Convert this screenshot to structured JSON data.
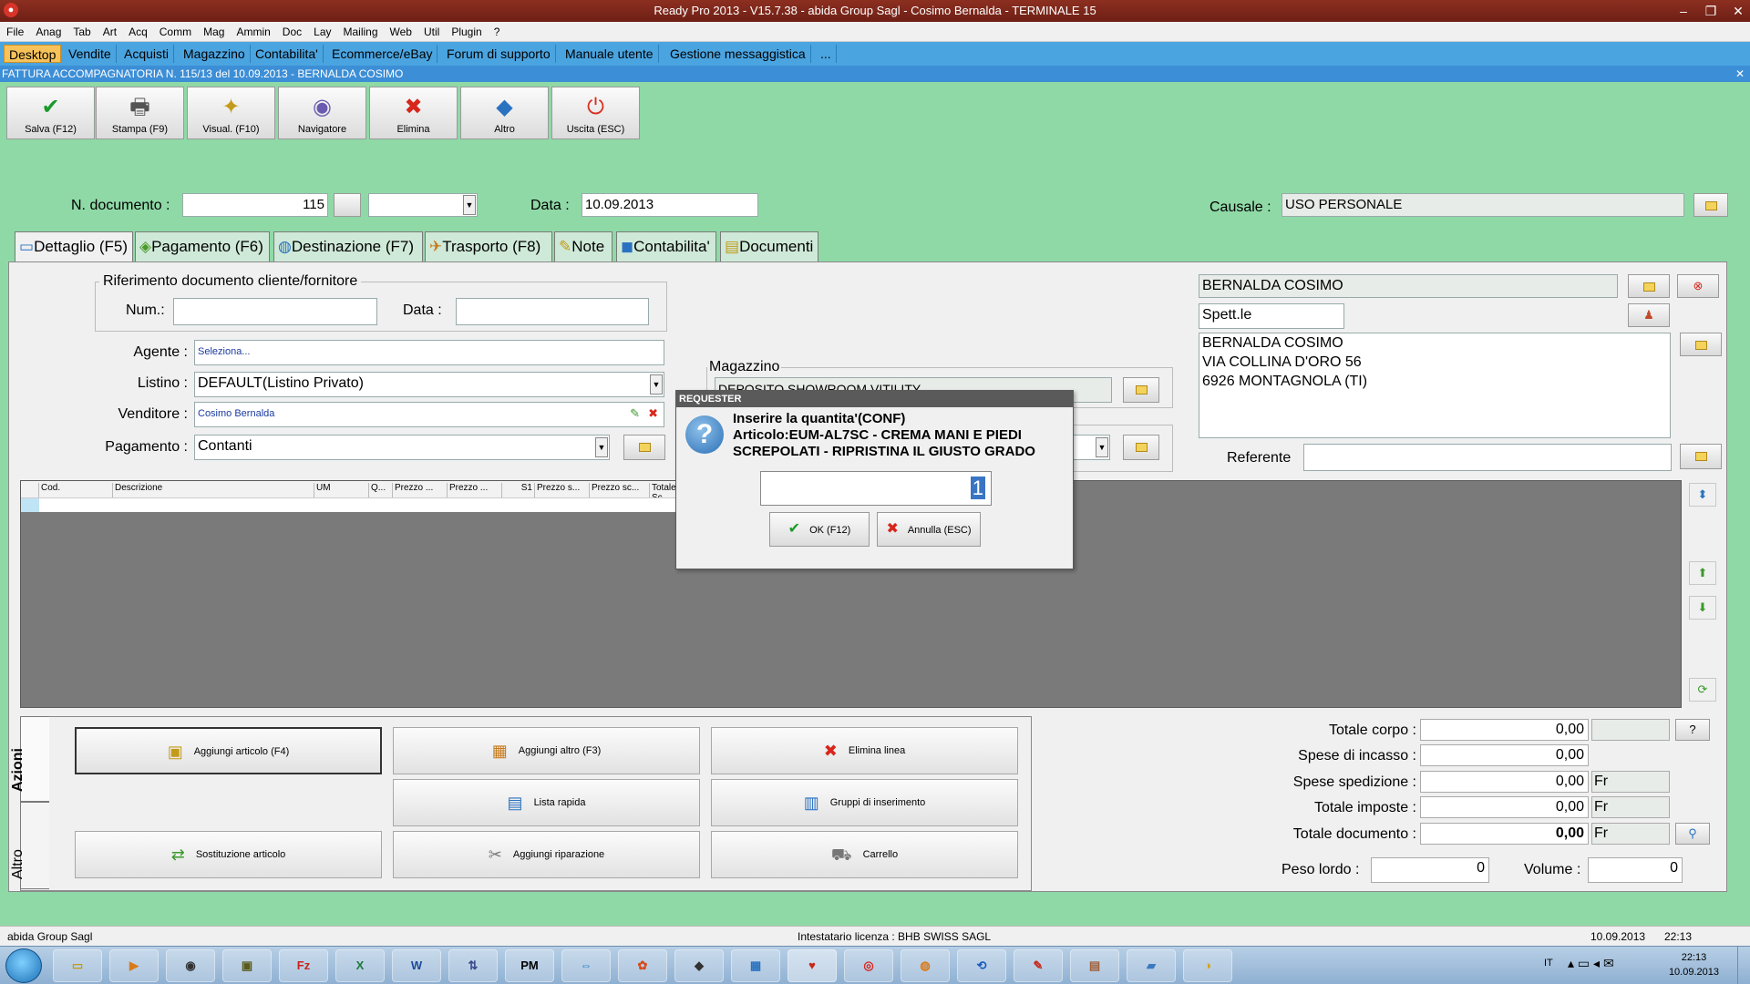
{
  "window": {
    "title": "Ready Pro 2013 - V15.7.38 - abida Group Sagl - Cosimo Bernalda - TERMINALE 15"
  },
  "menu": [
    "File",
    "Anag",
    "Tab",
    "Art",
    "Acq",
    "Comm",
    "Mag",
    "Ammin",
    "Doc",
    "Lay",
    "Mailing",
    "Web",
    "Util",
    "Plugin",
    "?"
  ],
  "top_tabs": [
    "Desktop",
    "Vendite",
    "Acquisti",
    "Magazzino",
    "Contabilita'",
    "Ecommerce/eBay",
    "Forum di supporto",
    "Manuale utente",
    "Gestione messaggistica",
    "..."
  ],
  "doc_title": "FATTURA ACCOMPAGNATORIA N. 115/13 del 10.09.2013 - BERNALDA COSIMO",
  "toolbar": [
    {
      "label": "Salva (F12)",
      "icon": "check-icon"
    },
    {
      "label": "Stampa (F9)",
      "icon": "printer-icon"
    },
    {
      "label": "Visual. (F10)",
      "icon": "wand-icon"
    },
    {
      "label": "Navigatore",
      "icon": "navigator-icon"
    },
    {
      "label": "Elimina",
      "icon": "delete-icon"
    },
    {
      "label": "Altro",
      "icon": "other-icon"
    },
    {
      "label": "Uscita (ESC)",
      "icon": "exit-icon"
    }
  ],
  "header": {
    "ndoc_label": "N. documento :",
    "ndoc_value": "115",
    "data_label": "Data :",
    "data_value": "10.09.2013",
    "causale_label": "Causale :",
    "causale_value": "USO PERSONALE"
  },
  "content_tabs": [
    "Dettaglio (F5)",
    "Pagamento (F6)",
    "Destinazione (F7)",
    "Trasporto (F8)",
    "Note",
    "Contabilita'",
    "Documenti"
  ],
  "riferimento": {
    "legend": "Riferimento documento cliente/fornitore",
    "num_label": "Num.:",
    "data_label": "Data :"
  },
  "fields": {
    "agente_label": "Agente :",
    "agente_value": "Seleziona...",
    "listino_label": "Listino :",
    "listino_value": "DEFAULT(Listino Privato)",
    "venditore_label": "Venditore :",
    "venditore_value": "Cosimo Bernalda",
    "pagamento_label": "Pagamento :",
    "pagamento_value": "Contanti",
    "magazzino_label": "Magazzino",
    "magazzino_value": "DEPOSITO SHOWROOM VITILITY"
  },
  "client": {
    "name": "BERNALDA COSIMO",
    "salutation": "Spett.le",
    "address_lines": [
      "BERNALDA COSIMO",
      "VIA COLLINA D'ORO 56",
      "6926 MONTAGNOLA (TI)"
    ],
    "referente_label": "Referente"
  },
  "grid_columns": [
    "Cod.",
    "Descrizione",
    "UM",
    "Q...",
    "Prezzo ...",
    "Prezzo ...",
    "S1",
    "Prezzo s...",
    "Prezzo sc...",
    "Totale Sc..."
  ],
  "actions_tabs": [
    "Azioni",
    "Altro"
  ],
  "actions": [
    {
      "label": "Aggiungi articolo (F4)",
      "icon": "add-article-icon"
    },
    {
      "label": "Aggiungi altro (F3)",
      "icon": "add-other-icon"
    },
    {
      "label": "Elimina linea",
      "icon": "delete-line-icon"
    },
    {
      "label": "Lista rapida",
      "icon": "quick-list-icon"
    },
    {
      "label": "Gruppi di inserimento",
      "icon": "insert-groups-icon"
    },
    {
      "label": "Sostituzione articolo",
      "icon": "replace-article-icon"
    },
    {
      "label": "Aggiungi riparazione",
      "icon": "add-repair-icon"
    },
    {
      "label": "Carrello",
      "icon": "cart-icon"
    }
  ],
  "totals": {
    "totale_corpo_label": "Totale corpo :",
    "totale_corpo": "0,00",
    "spese_incasso_label": "Spese di incasso :",
    "spese_incasso": "0,00",
    "spese_spedizione_label": "Spese spedizione :",
    "spese_spedizione": "0,00",
    "totale_imposte_label": "Totale imposte :",
    "totale_imposte": "0,00",
    "totale_documento_label": "Totale documento :",
    "totale_documento": "0,00",
    "currency": "Fr",
    "peso_label": "Peso lordo :",
    "peso": "0",
    "volume_label": "Volume :",
    "volume": "0",
    "help": "?"
  },
  "dialog": {
    "title": "REQUESTER",
    "line1": "Inserire la quantita'(CONF)",
    "line2": "Articolo:EUM-AL7SC - CREMA MANI E PIEDI",
    "line3": "SCREPOLATI - RIPRISTINA IL GIUSTO GRADO",
    "value": "1",
    "ok_label": "OK (F12)",
    "cancel_label": "Annulla (ESC)"
  },
  "status": {
    "company": "abida Group Sagl",
    "license": "Intestatario licenza : BHB SWISS SAGL",
    "date": "10.09.2013",
    "time": "22:13"
  },
  "taskbar": {
    "lang": "IT",
    "clock_time": "22:13",
    "clock_date": "10.09.2013"
  },
  "colors": {
    "accent": "#4aa4e0",
    "background": "#8fd9a6",
    "title": "#8c2f20"
  }
}
